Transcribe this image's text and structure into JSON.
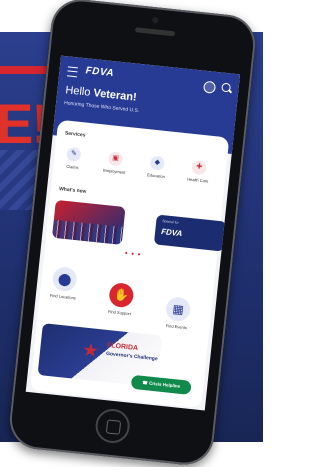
{
  "background": {
    "banner_text": "E!"
  },
  "header": {
    "logo": "FDVA",
    "greeting_prefix": "Hello",
    "greeting_name": "Veteran!",
    "tagline": "Honoring Those Who Served U.S."
  },
  "services": {
    "title": "Services",
    "items": [
      {
        "label": "Claims",
        "icon": "pencil-icon"
      },
      {
        "label": "Employment",
        "icon": "briefcase-icon"
      },
      {
        "label": "Education",
        "icon": "graduation-cap-icon"
      },
      {
        "label": "Health Care",
        "icon": "medical-cross-icon"
      }
    ]
  },
  "whats_new": {
    "title": "What's new",
    "card2_small": "Special for",
    "card2_brand": "FDVA"
  },
  "finders": [
    {
      "label": "Find Locations",
      "icon": "location-pin-icon"
    },
    {
      "label": "Find Support",
      "icon": "handshake-icon"
    },
    {
      "label": "Find Events",
      "icon": "calendar-icon"
    }
  ],
  "promo": {
    "title": "FLORIDA",
    "subtitle": "Governor's Challenge"
  },
  "helpline": {
    "label": "Crisis Helpline"
  },
  "colors": {
    "header_blue": "#273a94",
    "accent_red": "#d9262f",
    "helpline_green": "#0f8a4b"
  }
}
